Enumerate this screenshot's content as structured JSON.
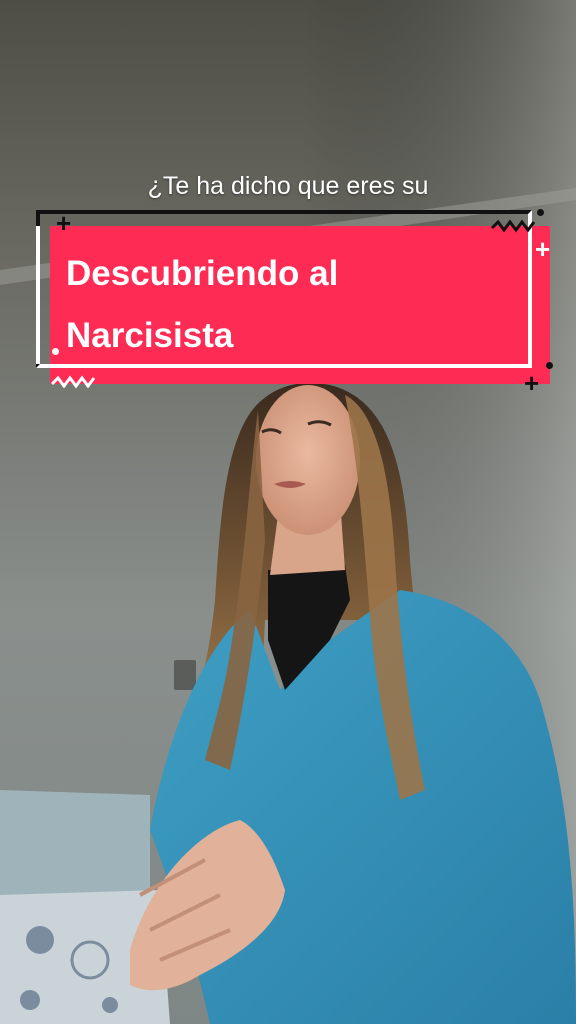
{
  "caption": {
    "line1": "¿Te ha dicho que eres su"
  },
  "title_card": {
    "line1": "Descubriendo al",
    "line2": "Narcisista",
    "accent_color": "#fe2c55"
  },
  "decorations": {
    "plus": "+",
    "zigzag": "zigzag-decoration",
    "dot": "dot-decoration"
  }
}
